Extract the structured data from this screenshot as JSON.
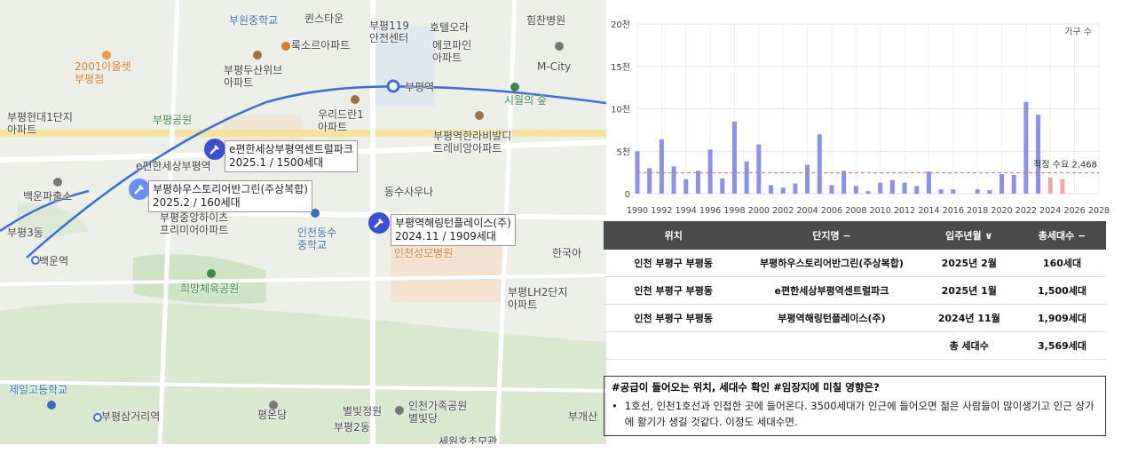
{
  "map": {
    "labels": [
      {
        "id": "l1",
        "text": "부원중학교",
        "cls": "blue"
      },
      {
        "id": "l2",
        "text": "퀸스타운",
        "cls": "dark"
      },
      {
        "id": "l3",
        "text": "부평119\n안전센터",
        "cls": "dark"
      },
      {
        "id": "l4",
        "text": "호텔오라",
        "cls": "dark"
      },
      {
        "id": "l5",
        "text": "힘찬병원",
        "cls": "dark"
      },
      {
        "id": "l6",
        "text": "룩소르아파트",
        "cls": "dark"
      },
      {
        "id": "l7",
        "text": "에코파인\n아파트",
        "cls": "dark"
      },
      {
        "id": "l8",
        "text": "M-City",
        "cls": "dark"
      },
      {
        "id": "l9",
        "text": "2001아울렛\n부평점",
        "cls": "orange"
      },
      {
        "id": "l10",
        "text": "부평두산위브\n아파트",
        "cls": "dark"
      },
      {
        "id": "l11",
        "text": "부평역",
        "cls": "dark"
      },
      {
        "id": "l12",
        "text": "시월의 숲",
        "cls": "green"
      },
      {
        "id": "l13",
        "text": "부평현대1단지\n아파트",
        "cls": "dark"
      },
      {
        "id": "l14",
        "text": "부평공원",
        "cls": "green"
      },
      {
        "id": "l15",
        "text": "우리드란1\n아파트",
        "cls": "dark"
      },
      {
        "id": "l16",
        "text": "부평역한라비발디\n트레비앙아파트",
        "cls": "dark"
      },
      {
        "id": "l17",
        "text": "e편한세상부평역",
        "cls": "dark"
      },
      {
        "id": "l18",
        "text": "백운파출소",
        "cls": "dark"
      },
      {
        "id": "l19",
        "text": "동수사우나",
        "cls": "dark"
      },
      {
        "id": "l20",
        "text": "부평중앙하이츠\n프리미어아파트",
        "cls": "dark"
      },
      {
        "id": "l21",
        "text": "인천동수\n중학교",
        "cls": "blue"
      },
      {
        "id": "l22",
        "text": "인천성모병원",
        "cls": "orange"
      },
      {
        "id": "l23",
        "text": "부평3동",
        "cls": "dark"
      },
      {
        "id": "l24",
        "text": "백운역",
        "cls": "dark"
      },
      {
        "id": "l25",
        "text": "희망체육공원",
        "cls": "green"
      },
      {
        "id": "l26",
        "text": "부평LH2단지\n아파트",
        "cls": "dark"
      },
      {
        "id": "l27",
        "text": "한국아",
        "cls": "dark"
      },
      {
        "id": "l28",
        "text": "제일고등학교",
        "cls": "blue"
      },
      {
        "id": "l29",
        "text": "부평삼거리역",
        "cls": "dark"
      },
      {
        "id": "l30",
        "text": "평온당",
        "cls": "dark"
      },
      {
        "id": "l31",
        "text": "별빛정원",
        "cls": "dark"
      },
      {
        "id": "l32",
        "text": "인천가족공원\n별빛당",
        "cls": "dark"
      },
      {
        "id": "l33",
        "text": "부개산",
        "cls": "dark"
      },
      {
        "id": "l34",
        "text": "세원호초모관",
        "cls": "dark"
      },
      {
        "id": "l35",
        "text": "부평2동",
        "cls": "dark"
      }
    ],
    "callouts": [
      {
        "name": "e편한세상부평역센트럴파크",
        "line2": "2025.1 / 1500세대"
      },
      {
        "name": "부평하우스토리어반그린(주상복합)",
        "line2": "2025.2 / 160세대"
      },
      {
        "name": "부평역해링턴플레이스(주)",
        "line2": "2024.11 / 1909세대"
      }
    ]
  },
  "chart_data": {
    "type": "bar",
    "legend": "가구 수",
    "y_ticks": [
      "0",
      "5천",
      "10천",
      "15천",
      "20천"
    ],
    "ylim": [
      0,
      20000
    ],
    "x_ticks": [
      "1990",
      "1992",
      "1994",
      "1996",
      "1998",
      "2000",
      "2002",
      "2004",
      "2006",
      "2008",
      "2010",
      "2012",
      "2014",
      "2016",
      "2018",
      "2020",
      "2022",
      "2024",
      "2026",
      "2028"
    ],
    "bars": [
      {
        "year": 1990,
        "value": 5000
      },
      {
        "year": 1991,
        "value": 3000
      },
      {
        "year": 1992,
        "value": 6400
      },
      {
        "year": 1993,
        "value": 3200
      },
      {
        "year": 1994,
        "value": 1700
      },
      {
        "year": 1995,
        "value": 2700
      },
      {
        "year": 1996,
        "value": 5200
      },
      {
        "year": 1997,
        "value": 1800
      },
      {
        "year": 1998,
        "value": 8500
      },
      {
        "year": 1999,
        "value": 3800
      },
      {
        "year": 2000,
        "value": 5800
      },
      {
        "year": 2001,
        "value": 1000
      },
      {
        "year": 2002,
        "value": 700
      },
      {
        "year": 2003,
        "value": 1200
      },
      {
        "year": 2004,
        "value": 3400
      },
      {
        "year": 2005,
        "value": 7000
      },
      {
        "year": 2006,
        "value": 1000
      },
      {
        "year": 2007,
        "value": 2700
      },
      {
        "year": 2008,
        "value": 900
      },
      {
        "year": 2009,
        "value": 300
      },
      {
        "year": 2010,
        "value": 1300
      },
      {
        "year": 2011,
        "value": 1600
      },
      {
        "year": 2012,
        "value": 1300
      },
      {
        "year": 2013,
        "value": 900
      },
      {
        "year": 2014,
        "value": 2600
      },
      {
        "year": 2015,
        "value": 500
      },
      {
        "year": 2016,
        "value": 500
      },
      {
        "year": 2018,
        "value": 500
      },
      {
        "year": 2019,
        "value": 400
      },
      {
        "year": 2020,
        "value": 2300
      },
      {
        "year": 2021,
        "value": 2200
      },
      {
        "year": 2022,
        "value": 10800
      },
      {
        "year": 2023,
        "value": 9300
      }
    ],
    "future_bars": [
      {
        "year": 2024,
        "value": 1900
      },
      {
        "year": 2025,
        "value": 1700
      }
    ],
    "reference_line": {
      "label": "적정 수요 2,468",
      "value": 2468
    },
    "colors": {
      "bar": "#8c8ff2",
      "future": "#f2a7a0",
      "reference": "#e07070"
    }
  },
  "table": {
    "headers": [
      "위치",
      "단지명 −",
      "입주년월 ∨",
      "총세대수 −"
    ],
    "rows": [
      [
        "인천 부평구 부평동",
        "부평하우스토리어반그린(주상복합)",
        "2025년 2월",
        "160세대"
      ],
      [
        "인천 부평구 부평동",
        "e편한세상부평역센트럴파크",
        "2025년 1월",
        "1,500세대"
      ],
      [
        "인천 부평구 부평동",
        "부평역해링턴플레이스(주)",
        "2024년 11월",
        "1,909세대"
      ]
    ],
    "total_label": "총 세대수",
    "total_value": "3,569세대"
  },
  "note": {
    "heading": "#공급이 들어오는 위치, 세대수 확인 #임장지에 미칠 영향은?",
    "bullet": "1호선, 인천1호선과 인접한 곳에 들어온다. 3500세대가 인근에 들어오면 젊은 사람들이 많이생기고 인근 상가에 활기가 생길 것같다. 이정도 세대수면."
  }
}
